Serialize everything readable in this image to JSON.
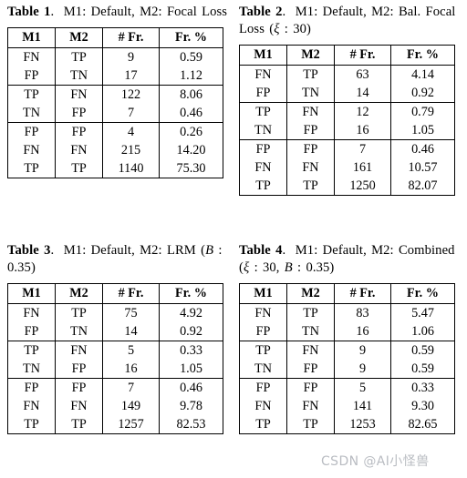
{
  "tables": [
    {
      "id": "table-1",
      "caption": {
        "label": "Table 1",
        "period": ".",
        "text_before": "M1: Default, M2: Focal Loss",
        "full": "Table 1. M1: Default, M2: Focal Loss"
      },
      "columns": [
        "M1",
        "M2",
        "# Fr.",
        "Fr. %"
      ],
      "groups": [
        [
          [
            "FN",
            "TP",
            "9",
            "0.59"
          ],
          [
            "FP",
            "TN",
            "17",
            "1.12"
          ]
        ],
        [
          [
            "TP",
            "FN",
            "122",
            "8.06"
          ],
          [
            "TN",
            "FP",
            "7",
            "0.46"
          ]
        ],
        [
          [
            "FP",
            "FP",
            "4",
            "0.26"
          ],
          [
            "FN",
            "FN",
            "215",
            "14.20"
          ],
          [
            "TP",
            "TP",
            "1140",
            "75.30"
          ]
        ]
      ]
    },
    {
      "id": "table-2",
      "caption": {
        "label": "Table 2",
        "period": ".",
        "text_before": "M1: Default, M2: Bal. Focal Loss (",
        "param_symbol": "ξ",
        "param_value": " : 30)",
        "full": "Table 2. M1: Default, M2: Bal. Focal Loss (ξ : 30)"
      },
      "columns": [
        "M1",
        "M2",
        "# Fr.",
        "Fr. %"
      ],
      "groups": [
        [
          [
            "FN",
            "TP",
            "63",
            "4.14"
          ],
          [
            "FP",
            "TN",
            "14",
            "0.92"
          ]
        ],
        [
          [
            "TP",
            "FN",
            "12",
            "0.79"
          ],
          [
            "TN",
            "FP",
            "16",
            "1.05"
          ]
        ],
        [
          [
            "FP",
            "FP",
            "7",
            "0.46"
          ],
          [
            "FN",
            "FN",
            "161",
            "10.57"
          ],
          [
            "TP",
            "TP",
            "1250",
            "82.07"
          ]
        ]
      ]
    },
    {
      "id": "table-3",
      "caption": {
        "label": "Table 3",
        "period": ".",
        "text_before": "M1: Default, M2: LRM (",
        "param_symbol": "B",
        "param_value": " : 0.35)",
        "full": "Table 3. M1: Default, M2: LRM (B : 0.35)"
      },
      "columns": [
        "M1",
        "M2",
        "# Fr.",
        "Fr. %"
      ],
      "groups": [
        [
          [
            "FN",
            "TP",
            "75",
            "4.92"
          ],
          [
            "FP",
            "TN",
            "14",
            "0.92"
          ]
        ],
        [
          [
            "TP",
            "FN",
            "5",
            "0.33"
          ],
          [
            "TN",
            "FP",
            "16",
            "1.05"
          ]
        ],
        [
          [
            "FP",
            "FP",
            "7",
            "0.46"
          ],
          [
            "FN",
            "FN",
            "149",
            "9.78"
          ],
          [
            "TP",
            "TP",
            "1257",
            "82.53"
          ]
        ]
      ]
    },
    {
      "id": "table-4",
      "caption": {
        "label": "Table 4",
        "period": ".",
        "text_before": "M1: Default, M2: Combined (",
        "param_symbol": "ξ",
        "param_value": " : 30, ",
        "param_symbol2": "B",
        "param_value2": " : 0.35)",
        "full": "Table 4. M1: Default, M2: Combined (ξ : 30, B : 0.35)"
      },
      "columns": [
        "M1",
        "M2",
        "# Fr.",
        "Fr. %"
      ],
      "groups": [
        [
          [
            "FN",
            "TP",
            "83",
            "5.47"
          ],
          [
            "FP",
            "TN",
            "16",
            "1.06"
          ]
        ],
        [
          [
            "TP",
            "FN",
            "9",
            "0.59"
          ],
          [
            "TN",
            "FP",
            "9",
            "0.59"
          ]
        ],
        [
          [
            "FP",
            "FP",
            "5",
            "0.33"
          ],
          [
            "FN",
            "FN",
            "141",
            "9.30"
          ],
          [
            "TP",
            "TP",
            "1253",
            "82.65"
          ]
        ]
      ]
    }
  ],
  "watermark": {
    "text": "CSDN @AI小怪兽",
    "color": "#b9bcc2"
  }
}
